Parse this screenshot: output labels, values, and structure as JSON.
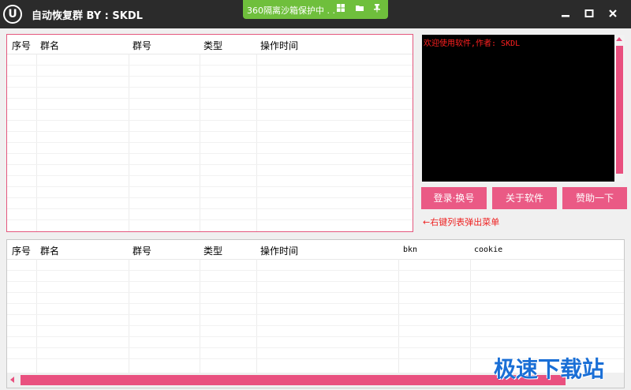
{
  "titlebar": {
    "logo_letter": "U",
    "title": "自动恢复群 BY : SKDL",
    "minimize": "▬",
    "maximize": "■",
    "close": "✕"
  },
  "sandbox": {
    "text": "360隔离沙箱保护中 . .",
    "icons": [
      "windows-icon",
      "folder-icon",
      "pin-icon"
    ]
  },
  "top_table": {
    "columns": [
      "序号",
      "群名",
      "群号",
      "类型",
      "操作时间"
    ]
  },
  "bottom_table": {
    "columns": [
      "序号",
      "群名",
      "群号",
      "类型",
      "操作时间",
      "bkn",
      "cookie"
    ]
  },
  "console": {
    "text": "欢迎使用软件,作者: SKDL"
  },
  "buttons": {
    "login": "登录·换号",
    "about": "关于软件",
    "donate": "赞助一下"
  },
  "hint": "←右键列表弹出菜单",
  "watermark": "极速下载站",
  "colors": {
    "titlebar_bg": "#2b2b2b",
    "accent": "#ea5a85",
    "sandbox_green": "#6fbf3c",
    "console_text": "#ff2020"
  }
}
